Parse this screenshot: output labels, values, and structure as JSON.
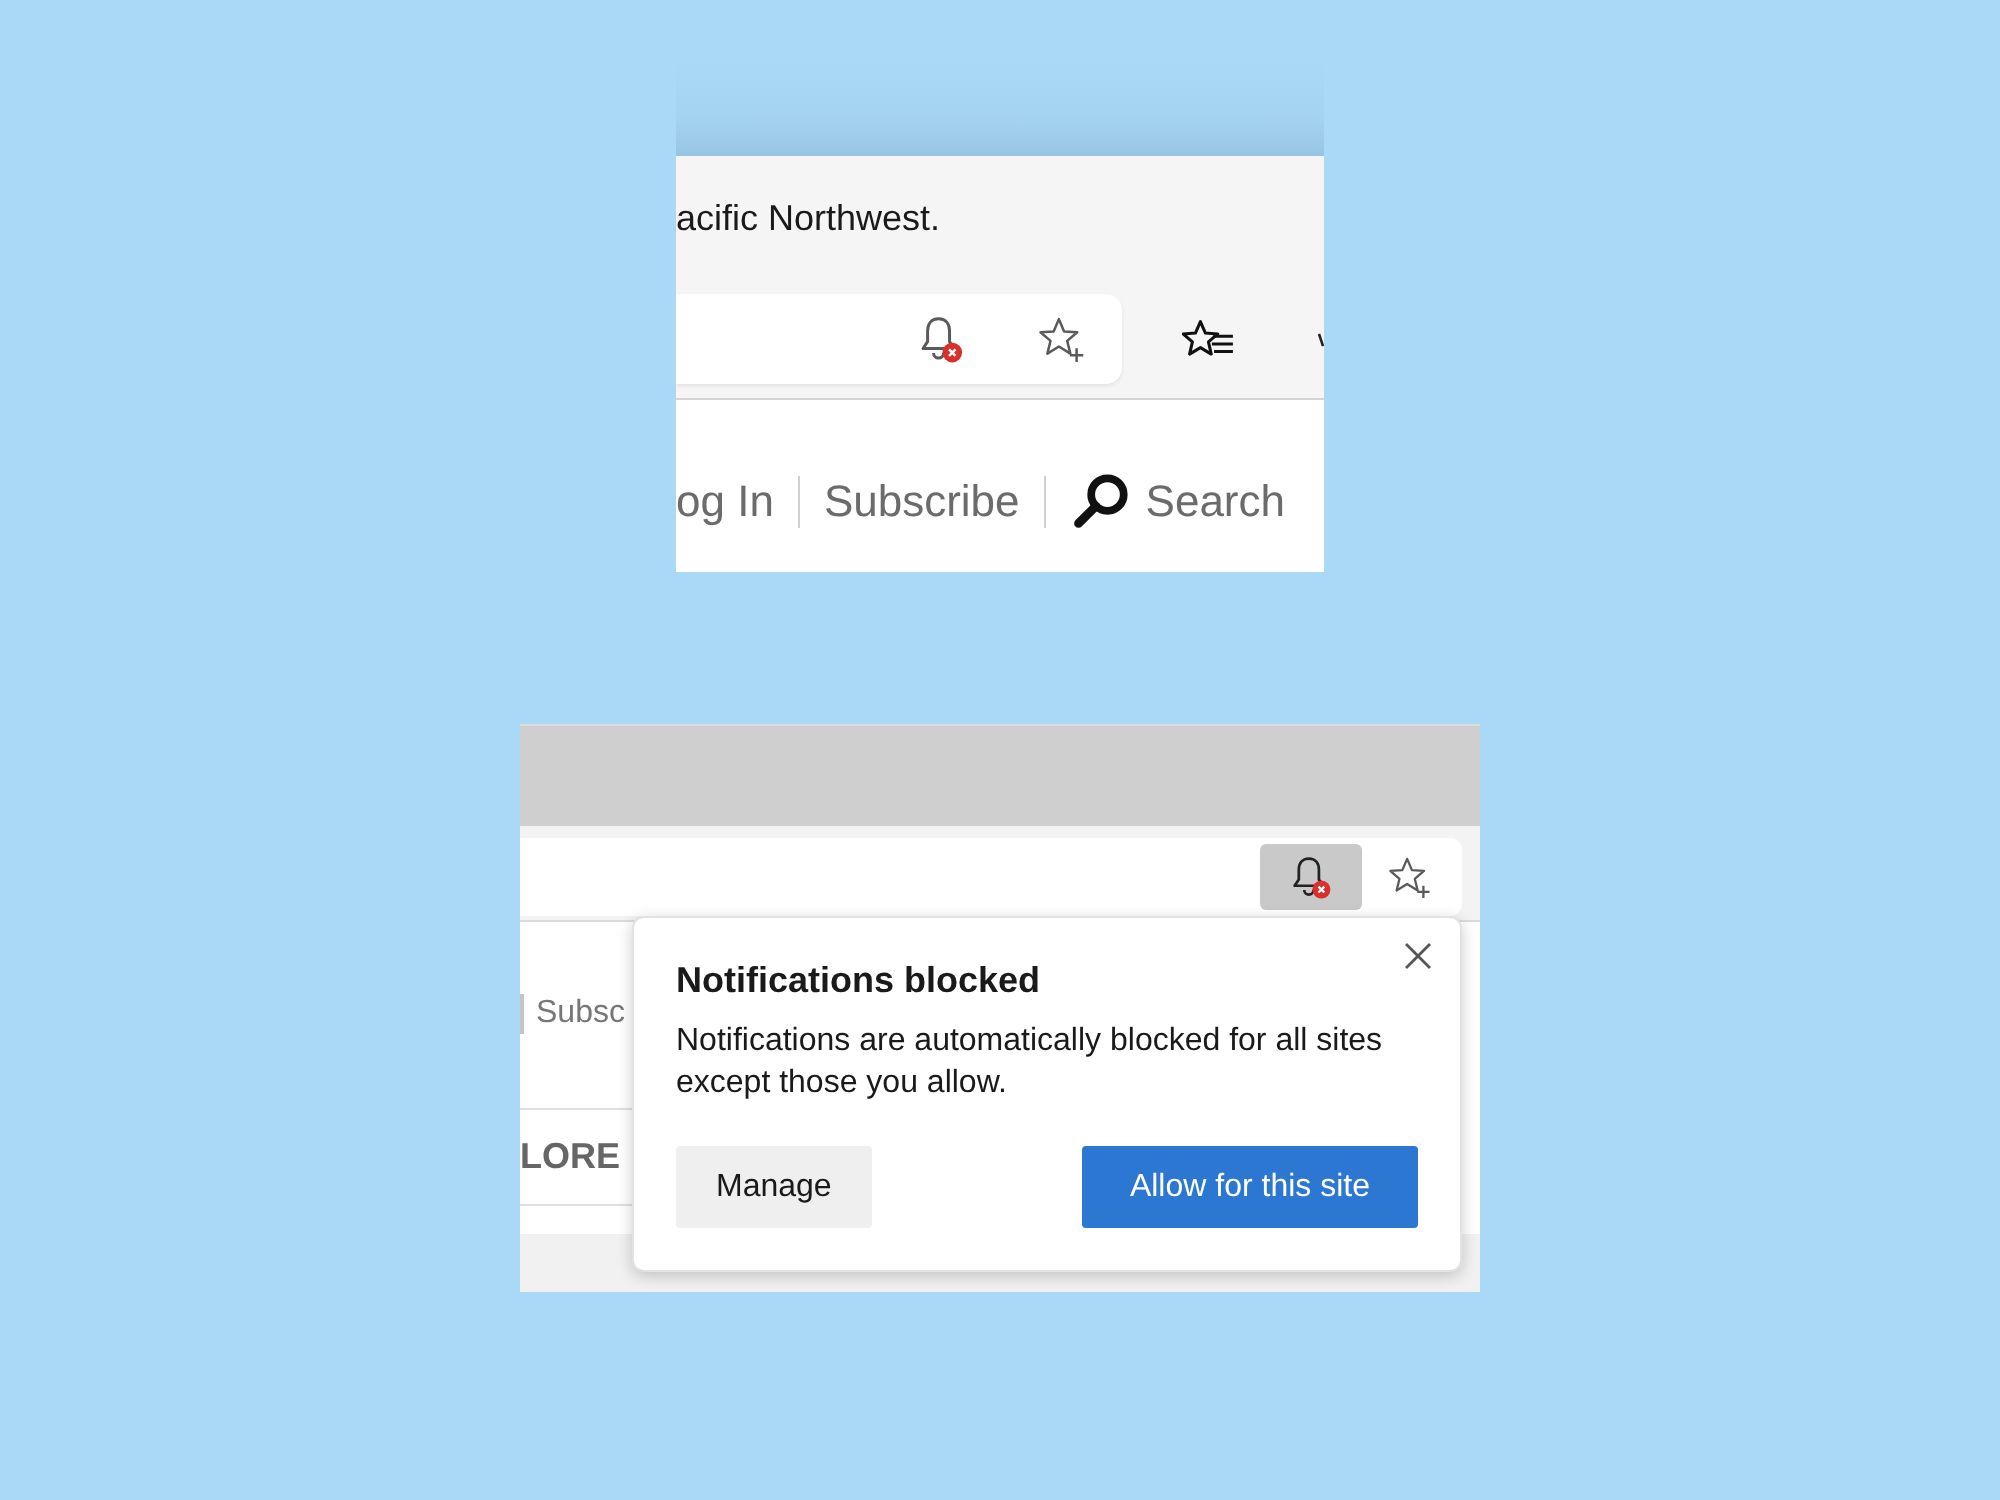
{
  "top_view": {
    "tagline": "acific Northwest.",
    "nav_links": [
      "og In",
      "Subscribe"
    ],
    "search_label": "Search"
  },
  "bottom_view": {
    "notification_button": {
      "pressed": true
    },
    "page_link": "Subsc",
    "menu_item": "LORE",
    "popup": {
      "title": "Notifications blocked",
      "message": "Notifications are automatically blocked for all sites except those you allow.",
      "buttons": [
        {
          "label": "Manage",
          "kind": "secondary"
        },
        {
          "label": "Allow for this site",
          "kind": "primary"
        }
      ]
    }
  }
}
